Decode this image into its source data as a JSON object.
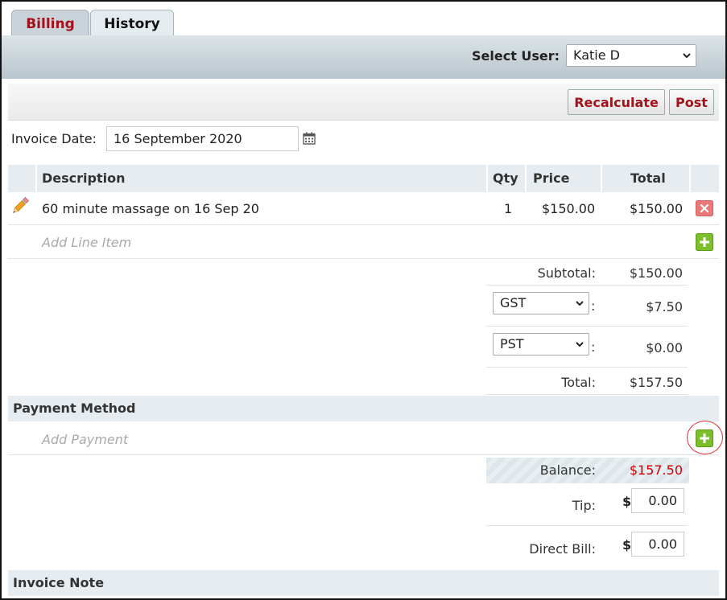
{
  "tabs": [
    {
      "label": "Billing",
      "active": true
    },
    {
      "label": "History",
      "active": false
    }
  ],
  "user_bar": {
    "label": "Select User:",
    "selected": "Katie D"
  },
  "actions": {
    "recalculate": "Recalculate",
    "post": "Post"
  },
  "invoice_date": {
    "label": "Invoice Date:",
    "value": "16 September 2020"
  },
  "table": {
    "headers": {
      "description": "Description",
      "qty": "Qty",
      "price": "Price",
      "total": "Total"
    },
    "rows": [
      {
        "description": "60 minute massage on 16 Sep 20",
        "qty": "1",
        "price": "$150.00",
        "total": "$150.00"
      }
    ],
    "add_line_item": "Add Line Item"
  },
  "totals": {
    "subtotal_label": "Subtotal:",
    "subtotal": "$150.00",
    "tax1": {
      "name": "GST",
      "colon": ":",
      "amount": "$7.50"
    },
    "tax2": {
      "name": "PST",
      "colon": ":",
      "amount": "$0.00"
    },
    "total_label": "Total:",
    "total": "$157.50"
  },
  "payment": {
    "section_title": "Payment Method",
    "add_payment": "Add Payment",
    "balance_label": "Balance:",
    "balance": "$157.50",
    "tip_label": "Tip:",
    "tip_currency": "$",
    "tip_value": "0.00",
    "direct_bill_label": "Direct Bill:",
    "direct_bill_currency": "$",
    "direct_bill_value": "0.00"
  },
  "invoice_note": {
    "section_title": "Invoice Note"
  },
  "colors": {
    "accent_red": "#a3121b",
    "balance_red": "#cc0000",
    "add_green": "#7bbf2a",
    "delete_red": "#e05555"
  }
}
